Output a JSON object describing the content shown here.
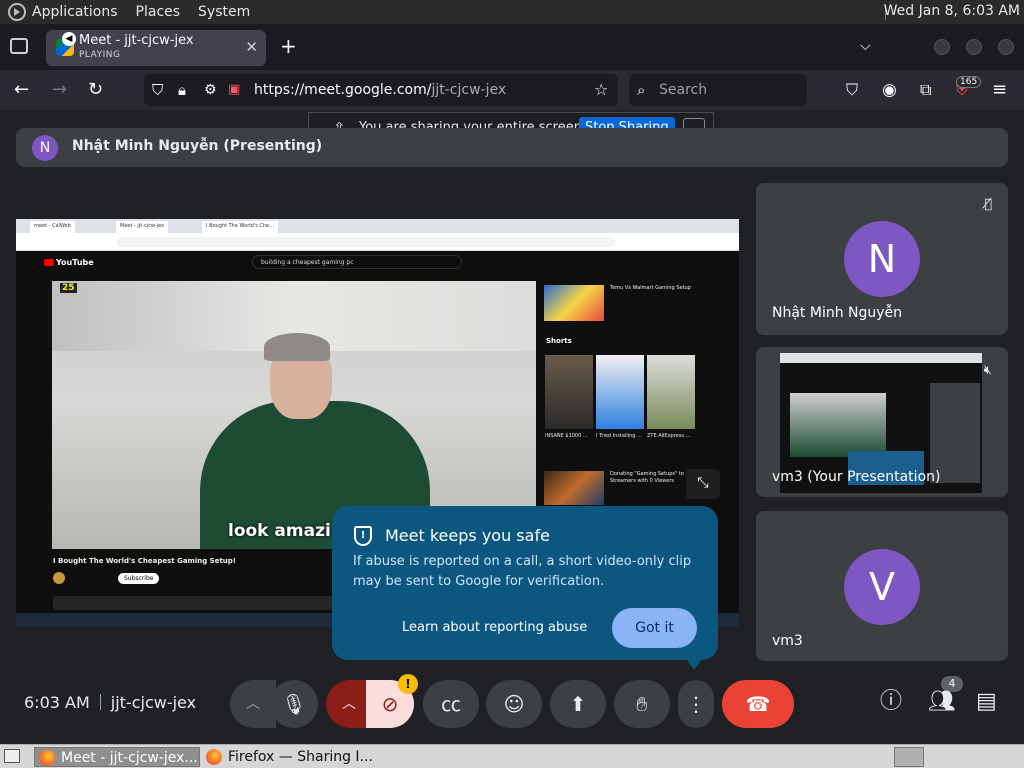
{
  "system": {
    "menus": [
      "Applications",
      "Places",
      "System"
    ],
    "clock": "Wed Jan  8,  6:03 AM"
  },
  "browser": {
    "tab": {
      "title": "Meet - jjt-cjcw-jex",
      "status": "PLAYING"
    },
    "url_host": "https://meet.google.com/",
    "url_path": "jjt-cjcw-jex",
    "search_placeholder": "Search",
    "extension_badge": "165"
  },
  "sharing_bar": {
    "message": "You are sharing your entire screen.",
    "stop_label": "Stop Sharing"
  },
  "meet": {
    "presenter_initial": "N",
    "presenter_label": "Nhật Minh Nguyễn (Presenting)",
    "shared_screen": {
      "tabs": [
        "meet - CalWeb",
        "Meet - jjt-cjcw-jex",
        "I Bought The World's Che..."
      ],
      "site": "YouTube",
      "search_query": "building a cheapest gaming pc",
      "timer": "25",
      "subtitle": "look amazi",
      "video_title": "I Bought The World's Cheapest Gaming Setup!",
      "subscribe": "Subscribe",
      "side1": "Temu Vs Walmart Gaming Setup",
      "shorts_label": "Shorts",
      "shorts": [
        "INSANE $1000 ...",
        "I Tried Installing ...",
        "ZTE AliExpress ..."
      ],
      "side2": "Donating \"Gaming Setups\" to Streamers with 0 Viewers"
    },
    "tiles": [
      {
        "initial": "N",
        "name": "Nhật Minh Nguyễn",
        "icon": "mic-off-icon"
      },
      {
        "name": "vm3 (Your Presentation)",
        "icon": "mic-off-icon"
      },
      {
        "initial": "V",
        "name": "vm3"
      }
    ],
    "popup": {
      "title": "Meet keeps you safe",
      "body": "If abuse is reported on a call, a short video-only clip may be sent to Google for verification.",
      "link": "Learn about reporting abuse",
      "button": "Got it"
    },
    "bottom": {
      "time": "6:03 AM",
      "meeting_code": "jjt-cjcw-jex",
      "participants_count": "4",
      "controls": [
        "chevron-up-icon",
        "mic-icon",
        "chevron-up-icon",
        "camera-off-icon",
        "captions-icon",
        "emoji-icon",
        "present-icon",
        "raise-hand-icon",
        "more-options-icon",
        "end-call-icon"
      ]
    },
    "colors": {
      "accent_blue": "#8ab4f8",
      "popup_bg": "#0b5780",
      "end_call": "#ea4335",
      "avatar": "#7e57c2"
    }
  },
  "taskbar": {
    "items": [
      "Meet - jjt-cjcw-jex...",
      "Firefox — Sharing I..."
    ]
  }
}
